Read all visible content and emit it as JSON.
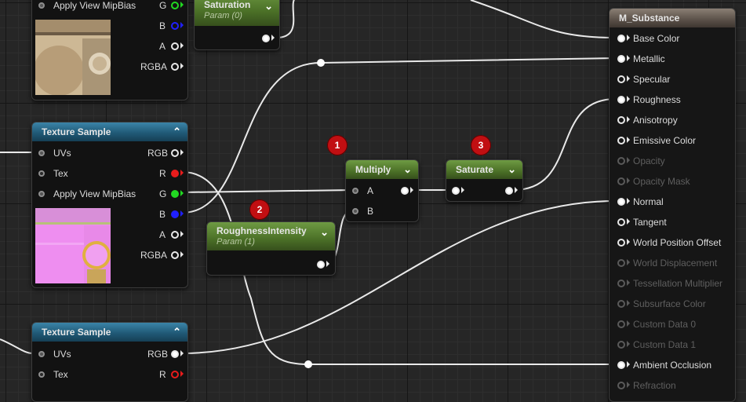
{
  "nodes": {
    "tex_top": {
      "rows": {
        "mip": "Apply View MipBias",
        "g": "G",
        "b": "B",
        "a": "A",
        "rgba": "RGBA"
      }
    },
    "saturation": {
      "title": "Saturation",
      "param": "Param (0)"
    },
    "tex_mid": {
      "title": "Texture Sample",
      "rows": {
        "uvs": "UVs",
        "tex": "Tex",
        "mip": "Apply View MipBias",
        "rgb": "RGB",
        "r": "R",
        "g": "G",
        "b": "B",
        "a": "A",
        "rgba": "RGBA"
      }
    },
    "tex_bot": {
      "title": "Texture Sample",
      "rows": {
        "uvs": "UVs",
        "tex": "Tex",
        "rgb": "RGB",
        "r": "R"
      }
    },
    "roughness": {
      "title": "RoughnessIntensity",
      "param": "Param (1)"
    },
    "multiply": {
      "title": "Multiply",
      "a": "A",
      "b": "B"
    },
    "saturate": {
      "title": "Saturate"
    },
    "material": {
      "title": "M_Substance",
      "pins": [
        "Base Color",
        "Metallic",
        "Specular",
        "Roughness",
        "Anisotropy",
        "Emissive Color",
        "Opacity",
        "Opacity Mask",
        "Normal",
        "Tangent",
        "World Position Offset",
        "World Displacement",
        "Tessellation Multiplier",
        "Subsurface Color",
        "Custom Data 0",
        "Custom Data 1",
        "Ambient Occlusion",
        "Refraction"
      ]
    }
  },
  "badges": [
    "1",
    "2",
    "3"
  ],
  "colors": {
    "red_pin": "#e81c1c",
    "green_pin": "#22d822",
    "blue_pin": "#2020ff",
    "badge": "#c10f12"
  }
}
